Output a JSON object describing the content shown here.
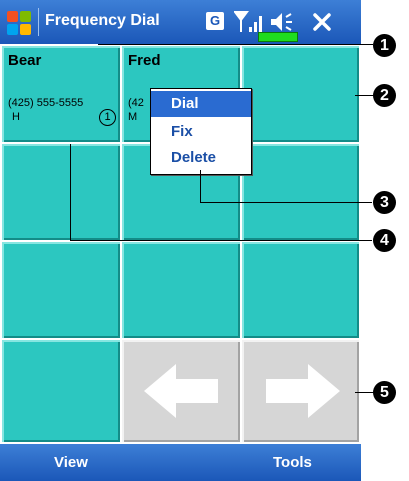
{
  "titlebar": {
    "title": "Frequency Dial",
    "status_g": "G",
    "colors": {
      "bar": "#1b57b8",
      "tile": "#2cc7c0",
      "nav_tile": "#d6d6d6",
      "menu_highlight": "#2a6bd1"
    }
  },
  "tiles": [
    {
      "name": "Bear",
      "phone": "(425) 555-5555",
      "type": "H",
      "slot": "1"
    },
    {
      "name": "Fred",
      "phone": "(42",
      "type": "M"
    }
  ],
  "context_menu": {
    "items": [
      "Dial",
      "Fix",
      "Delete"
    ],
    "selected": "Dial"
  },
  "menubar": {
    "left": "View",
    "right": "Tools"
  },
  "callouts": [
    "1",
    "2",
    "3",
    "4",
    "5"
  ]
}
